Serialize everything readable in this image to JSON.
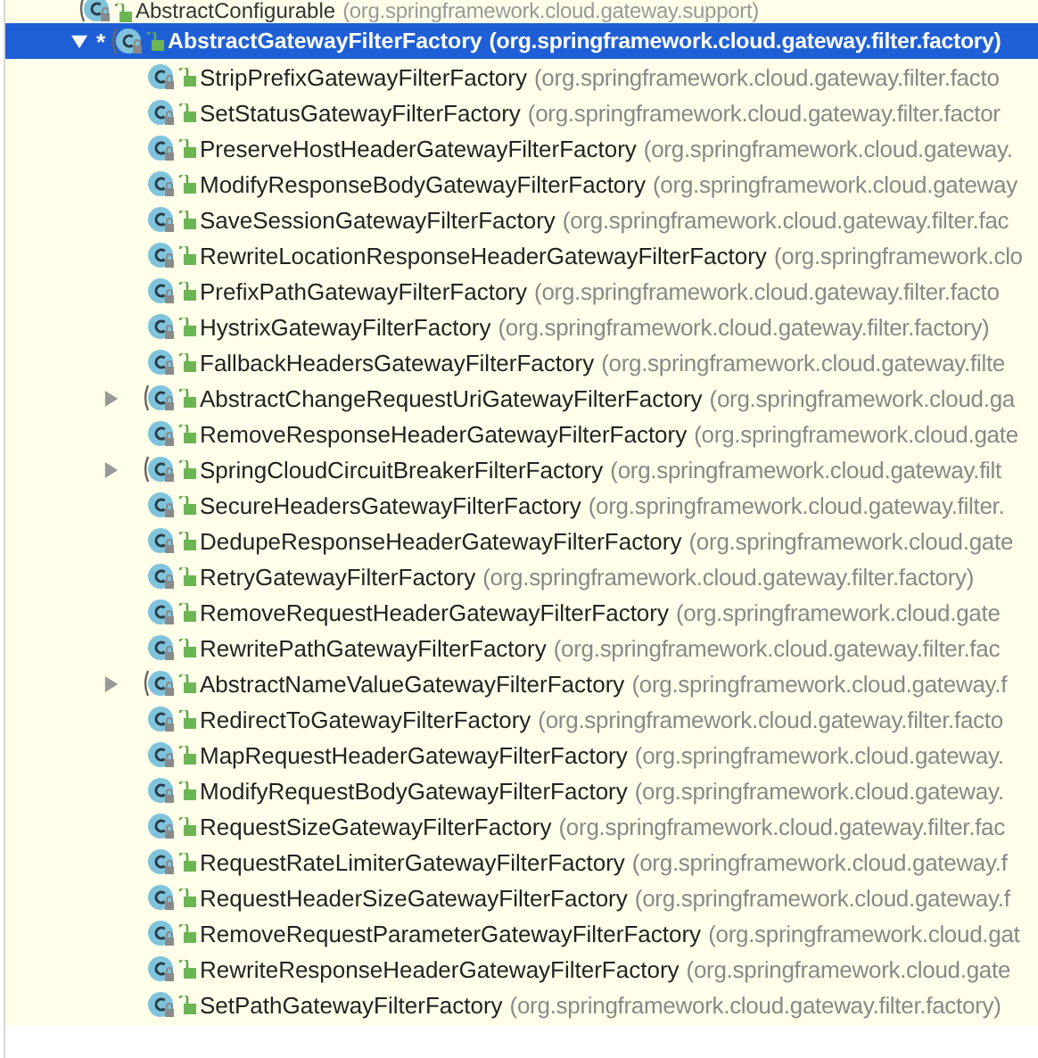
{
  "tree": [
    {
      "name": "AbstractConfigurable",
      "package": "(org.springframework.cloud.gateway.support)",
      "kind": "abstract",
      "selected": false,
      "children": [
        {
          "name": "AbstractGatewayFilterFactory",
          "package": "(org.springframework.cloud.gateway.filter.factory)",
          "kind": "abstract",
          "selected": true,
          "expanded": true,
          "marker": "*",
          "children": [
            {
              "name": "StripPrefixGatewayFilterFactory",
              "package": "(org.springframework.cloud.gateway.filter.facto",
              "kind": "class",
              "selected": false
            },
            {
              "name": "SetStatusGatewayFilterFactory",
              "package": "(org.springframework.cloud.gateway.filter.factor",
              "kind": "class",
              "selected": false
            },
            {
              "name": "PreserveHostHeaderGatewayFilterFactory",
              "package": "(org.springframework.cloud.gateway.",
              "kind": "class",
              "selected": false
            },
            {
              "name": "ModifyResponseBodyGatewayFilterFactory",
              "package": "(org.springframework.cloud.gateway",
              "kind": "class",
              "selected": false
            },
            {
              "name": "SaveSessionGatewayFilterFactory",
              "package": "(org.springframework.cloud.gateway.filter.fac",
              "kind": "class",
              "selected": false
            },
            {
              "name": "RewriteLocationResponseHeaderGatewayFilterFactory",
              "package": "(org.springframework.clo",
              "kind": "class",
              "selected": false
            },
            {
              "name": "PrefixPathGatewayFilterFactory",
              "package": "(org.springframework.cloud.gateway.filter.facto",
              "kind": "class",
              "selected": false
            },
            {
              "name": "HystrixGatewayFilterFactory",
              "package": "(org.springframework.cloud.gateway.filter.factory)",
              "kind": "class",
              "selected": false
            },
            {
              "name": "FallbackHeadersGatewayFilterFactory",
              "package": "(org.springframework.cloud.gateway.filte",
              "kind": "class",
              "selected": false
            },
            {
              "name": "AbstractChangeRequestUriGatewayFilterFactory",
              "package": "(org.springframework.cloud.ga",
              "kind": "abstract",
              "selected": false,
              "expanded": false
            },
            {
              "name": "RemoveResponseHeaderGatewayFilterFactory",
              "package": "(org.springframework.cloud.gate",
              "kind": "class",
              "selected": false
            },
            {
              "name": "SpringCloudCircuitBreakerFilterFactory",
              "package": "(org.springframework.cloud.gateway.filt",
              "kind": "abstract",
              "selected": false,
              "expanded": false
            },
            {
              "name": "SecureHeadersGatewayFilterFactory",
              "package": "(org.springframework.cloud.gateway.filter.",
              "kind": "class",
              "selected": false
            },
            {
              "name": "DedupeResponseHeaderGatewayFilterFactory",
              "package": "(org.springframework.cloud.gate",
              "kind": "class",
              "selected": false
            },
            {
              "name": "RetryGatewayFilterFactory",
              "package": "(org.springframework.cloud.gateway.filter.factory)",
              "kind": "class",
              "selected": false
            },
            {
              "name": "RemoveRequestHeaderGatewayFilterFactory",
              "package": "(org.springframework.cloud.gate",
              "kind": "class",
              "selected": false
            },
            {
              "name": "RewritePathGatewayFilterFactory",
              "package": "(org.springframework.cloud.gateway.filter.fac",
              "kind": "class",
              "selected": false
            },
            {
              "name": "AbstractNameValueGatewayFilterFactory",
              "package": "(org.springframework.cloud.gateway.f",
              "kind": "abstract",
              "selected": false,
              "expanded": false
            },
            {
              "name": "RedirectToGatewayFilterFactory",
              "package": "(org.springframework.cloud.gateway.filter.facto",
              "kind": "class",
              "selected": false
            },
            {
              "name": "MapRequestHeaderGatewayFilterFactory",
              "package": "(org.springframework.cloud.gateway.",
              "kind": "class",
              "selected": false
            },
            {
              "name": "ModifyRequestBodyGatewayFilterFactory",
              "package": "(org.springframework.cloud.gateway.",
              "kind": "class",
              "selected": false
            },
            {
              "name": "RequestSizeGatewayFilterFactory",
              "package": "(org.springframework.cloud.gateway.filter.fac",
              "kind": "class",
              "selected": false
            },
            {
              "name": "RequestRateLimiterGatewayFilterFactory",
              "package": "(org.springframework.cloud.gateway.f",
              "kind": "class",
              "selected": false
            },
            {
              "name": "RequestHeaderSizeGatewayFilterFactory",
              "package": "(org.springframework.cloud.gateway.f",
              "kind": "class",
              "selected": false
            },
            {
              "name": "RemoveRequestParameterGatewayFilterFactory",
              "package": "(org.springframework.cloud.gat",
              "kind": "class",
              "selected": false
            },
            {
              "name": "RewriteResponseHeaderGatewayFilterFactory",
              "package": "(org.springframework.cloud.gate",
              "kind": "class",
              "selected": false
            },
            {
              "name": "SetPathGatewayFilterFactory",
              "package": "(org.springframework.cloud.gateway.filter.factory)",
              "kind": "class",
              "selected": false
            }
          ]
        }
      ]
    }
  ]
}
